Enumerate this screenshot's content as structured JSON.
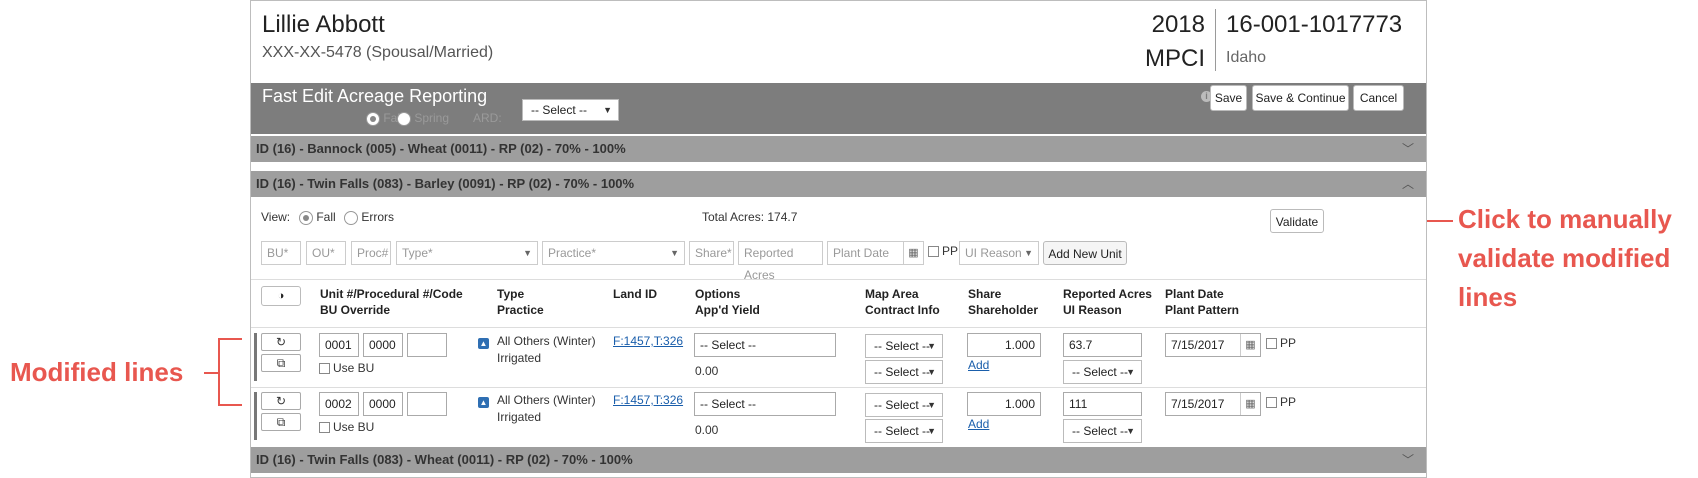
{
  "header": {
    "name": "Lillie Abbott",
    "ssn": "XXX-XX-5478 (Spousal/Married)",
    "year": "2018",
    "program": "MPCI",
    "policy_number": "16-001-1017773",
    "state": "Idaho"
  },
  "fast_edit": {
    "title": "Fast Edit Acreage Reporting",
    "season_fall": "Fall",
    "season_spring": "Spring",
    "ard_label": "ARD:",
    "ard_select": "-- Select --",
    "save": "Save",
    "save_continue": "Save & Continue",
    "cancel": "Cancel"
  },
  "sections": [
    {
      "label": "ID (16) - Bannock (005) - Wheat (0011) - RP (02) - 70% - 100%",
      "expanded": false
    },
    {
      "label": "ID (16) - Twin Falls (083) - Barley (0091) - RP (02) - 70% - 100%",
      "expanded": true
    },
    {
      "label": "ID (16) - Twin Falls (083) - Wheat (0011) - RP (02) - 70% - 100%",
      "expanded": false
    }
  ],
  "view": {
    "label": "View:",
    "fall": "Fall",
    "errors": "Errors",
    "total_acres_label": "Total Acres:",
    "total_acres": "174.7",
    "validate": "Validate"
  },
  "add_row": {
    "bu": "BU*",
    "ou": "OU*",
    "proc": "Proc#",
    "type": "Type*",
    "practice": "Practice*",
    "share": "Share*",
    "reported_acres": "Reported Acres",
    "plant_date": "Plant Date",
    "pp": "PP",
    "ui_reason": "UI Reason",
    "add_new_unit": "Add New Unit"
  },
  "columns": {
    "unit_1": "Unit #/Procedural #/Code",
    "unit_2": "BU Override",
    "type_1": "Type",
    "type_2": "Practice",
    "land": "Land ID",
    "options_1": "Options",
    "options_2": "App'd Yield",
    "map_1": "Map Area",
    "map_2": "Contract Info",
    "share_1": "Share",
    "share_2": "Shareholder",
    "acres_1": "Reported Acres",
    "acres_2": "UI Reason",
    "plant_1": "Plant Date",
    "plant_2": "Plant Pattern"
  },
  "rows": [
    {
      "unit": "0001",
      "proc": "0000",
      "code": "",
      "use_bu": "Use BU",
      "type": "All Others (Winter)",
      "practice": "Irrigated",
      "land_id": "F:1457,T:326",
      "options": "-- Select --",
      "appd_yield": "0.00",
      "map_area": "-- Select --",
      "contract": "-- Select --",
      "share": "1.000",
      "add": "Add",
      "acres": "63.7",
      "ui_reason": "-- Select --",
      "plant_date": "7/15/2017",
      "pp": "PP"
    },
    {
      "unit": "0002",
      "proc": "0000",
      "code": "",
      "use_bu": "Use BU",
      "type": "All Others (Winter)",
      "practice": "Irrigated",
      "land_id": "F:1457,T:326",
      "options": "-- Select --",
      "appd_yield": "0.00",
      "map_area": "-- Select --",
      "contract": "-- Select --",
      "share": "1.000",
      "add": "Add",
      "acres": "111",
      "ui_reason": "-- Select --",
      "plant_date": "7/15/2017",
      "pp": "PP"
    }
  ],
  "annotations": {
    "modified": "Modified lines",
    "validate_1": "Click to manually",
    "validate_2": "validate modified",
    "validate_3": "lines"
  }
}
